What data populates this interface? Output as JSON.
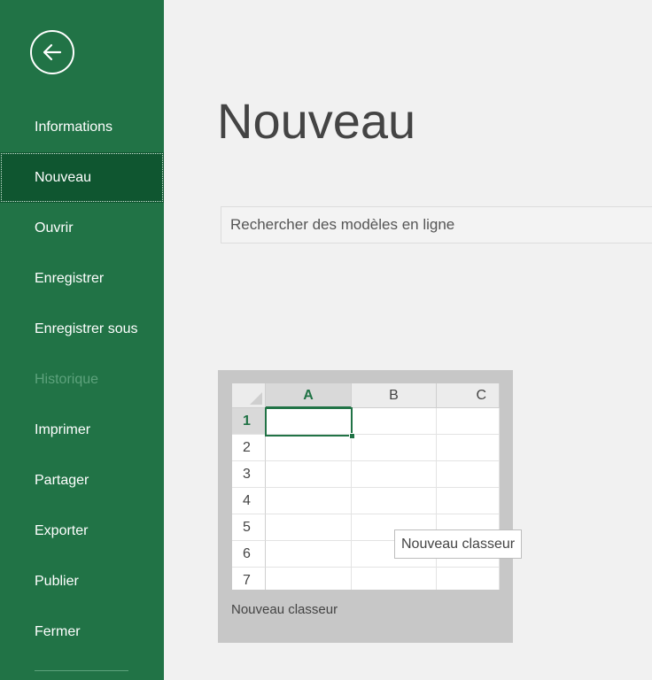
{
  "sidebar": {
    "back_icon": "back-arrow-icon",
    "items": [
      {
        "label": "Informations",
        "state": "normal"
      },
      {
        "label": "Nouveau",
        "state": "active"
      },
      {
        "label": "Ouvrir",
        "state": "normal"
      },
      {
        "label": "Enregistrer",
        "state": "normal"
      },
      {
        "label": "Enregistrer sous",
        "state": "normal"
      },
      {
        "label": "Historique",
        "state": "disabled"
      },
      {
        "label": "Imprimer",
        "state": "normal"
      },
      {
        "label": "Partager",
        "state": "normal"
      },
      {
        "label": "Exporter",
        "state": "normal"
      },
      {
        "label": "Publier",
        "state": "normal"
      },
      {
        "label": "Fermer",
        "state": "normal"
      }
    ]
  },
  "main": {
    "title": "Nouveau",
    "search": {
      "placeholder": "Rechercher des modèles en ligne",
      "value": ""
    },
    "template": {
      "label": "Nouveau classeur",
      "columns": [
        "A",
        "B",
        "C"
      ],
      "rows": [
        "1",
        "2",
        "3",
        "4",
        "5",
        "6",
        "7"
      ],
      "selected_column": "A",
      "selected_row": "1"
    },
    "tooltip": "Nouveau classeur"
  },
  "colors": {
    "accent": "#217346",
    "active_nav": "#0f5630",
    "disabled_nav": "#5da27c",
    "background": "#f1f1f1"
  }
}
